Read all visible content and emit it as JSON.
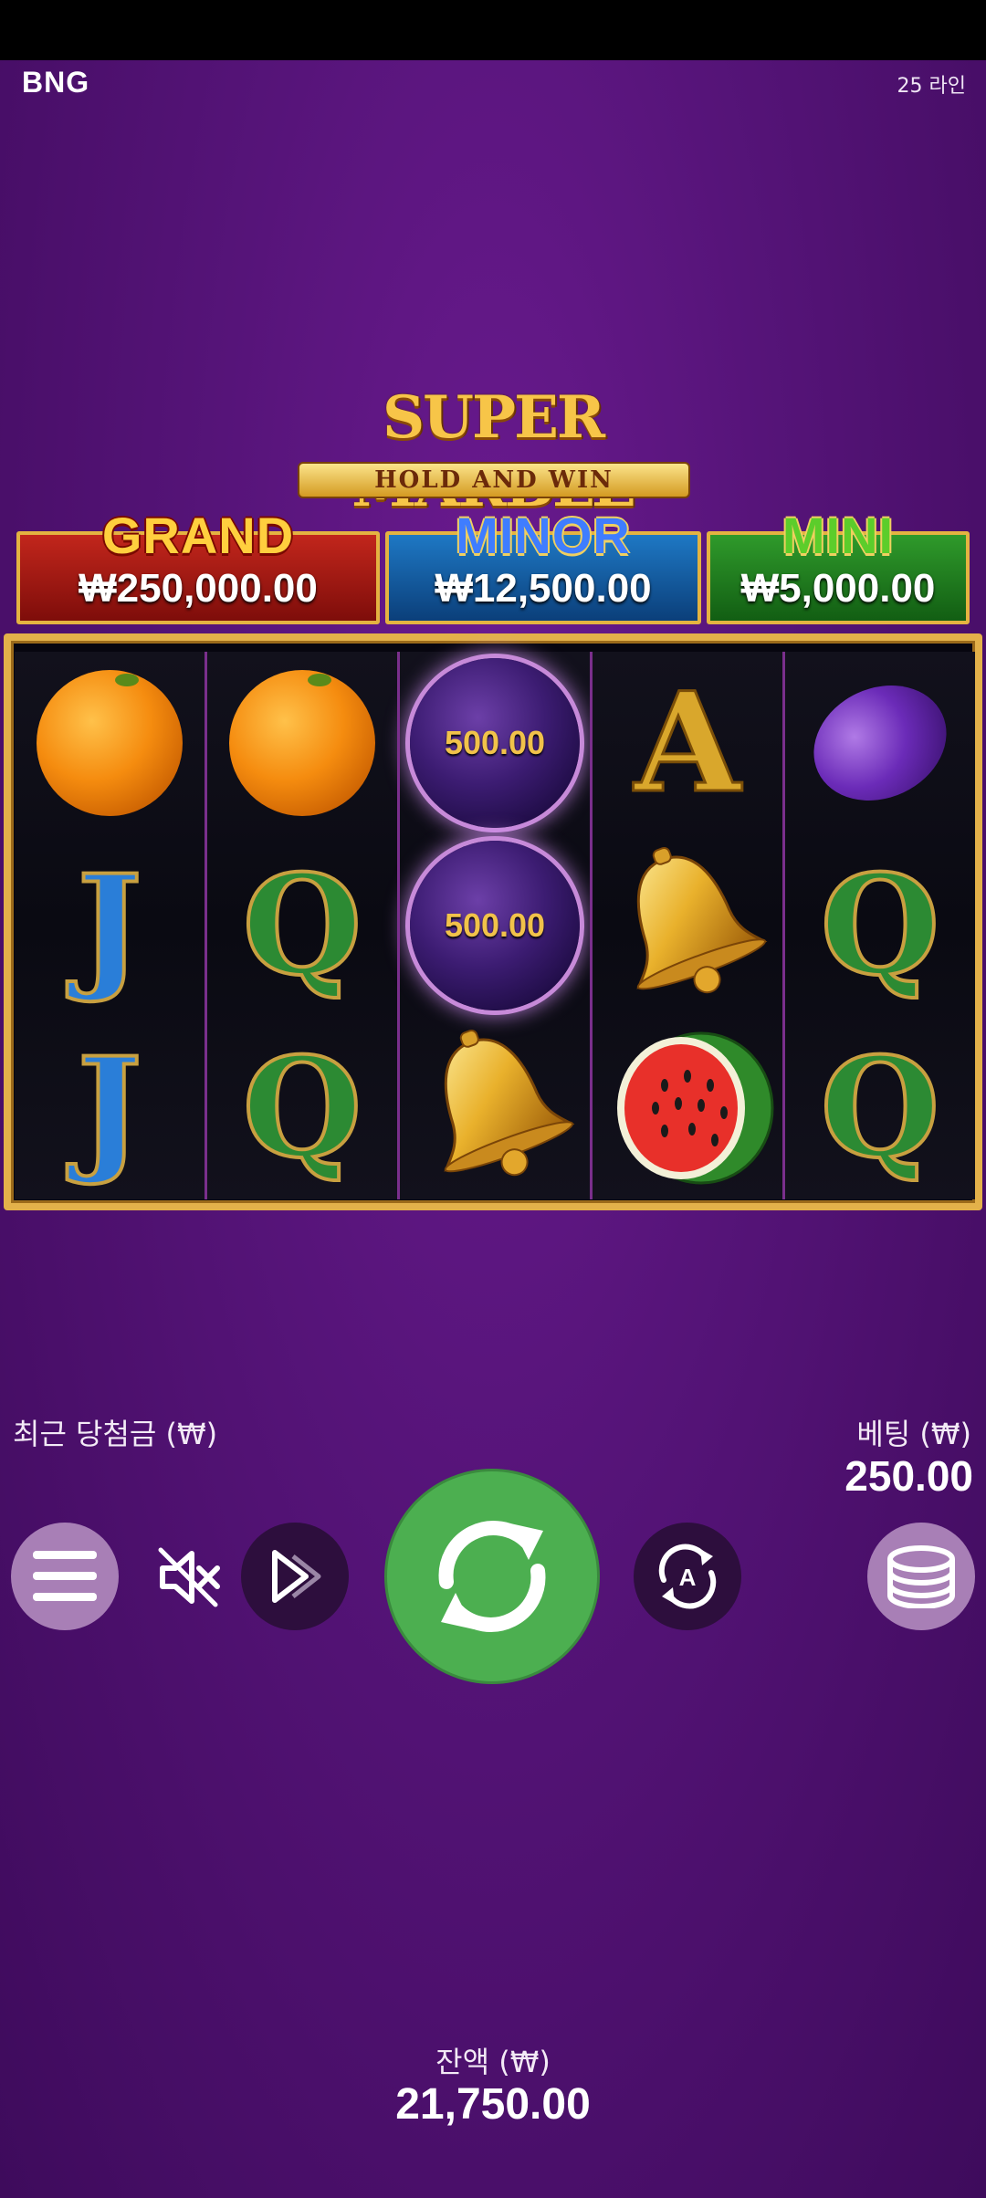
{
  "header": {
    "provider": "BNG",
    "lines": "25 라인"
  },
  "logo": {
    "title": "SUPER MARBLE",
    "subtitle": "HOLD AND WIN"
  },
  "jackpots": [
    {
      "name": "GRAND",
      "value": "₩250,000.00",
      "color": "#c2261c"
    },
    {
      "name": "MINOR",
      "value": "₩12,500.00",
      "color": "#1e78c4"
    },
    {
      "name": "MINI",
      "value": "₩5,000.00",
      "color": "#2f9a2b"
    }
  ],
  "reels": {
    "grid": [
      [
        "orange",
        "orange",
        "marble",
        "A",
        "plum"
      ],
      [
        "J",
        "Q",
        "marble",
        "bell",
        "Q"
      ],
      [
        "J",
        "Q",
        "bell",
        "watermelon",
        "Q"
      ]
    ],
    "marbles": [
      "500.00",
      "500.00"
    ]
  },
  "controls": {
    "last_win_label": "최근 당첨금 (₩)",
    "bet_label": "베팅 (₩)",
    "bet_value": "250.00",
    "balance_label": "잔액 (₩)",
    "balance_value": "21,750.00",
    "icons": [
      "menu-icon",
      "sound-muted-icon",
      "turbo-icon",
      "spin-icon",
      "autoplay-icon",
      "coins-icon"
    ]
  }
}
